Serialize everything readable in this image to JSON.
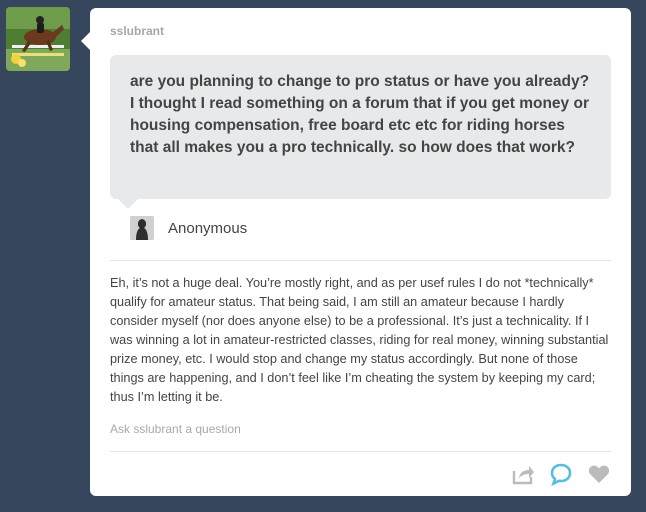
{
  "colors": {
    "background": "#36465d",
    "card": "#ffffff",
    "ask_bubble": "#e7e9eb",
    "text": "#444444",
    "muted": "#a9a9a9",
    "reply_icon": "#56bce0",
    "icon_gray": "#bbbbbb"
  },
  "post": {
    "blog_name": "sslubrant",
    "ask": {
      "question": "are you planning to change to pro status or have you already? I thought I read something on a forum that if you get money or housing compensation, free board etc etc for riding horses that all makes you a pro technically. so how does that work?",
      "asker_name": "Anonymous",
      "asker_icon": "anonymous-silhouette-icon"
    },
    "answer": "Eh, it’s not a huge deal. You’re mostly right, and as per usef rules I do not *technically* qualify for amateur status. That being said, I am still an amateur because I hardly consider myself (nor does anyone else) to be a professional. It’s just a technicality. If I was winning a lot in amateur-restricted classes, riding for real money, winning substantial prize money, etc. I would stop and change my status accordingly. But none of those things are happening, and I don’t feel like I’m cheating the system by keeping my card; thus I’m letting it be.",
    "ask_link": "Ask sslubrant a question"
  },
  "footer": {
    "actions": [
      "share-icon",
      "reply-icon",
      "like-icon"
    ]
  }
}
